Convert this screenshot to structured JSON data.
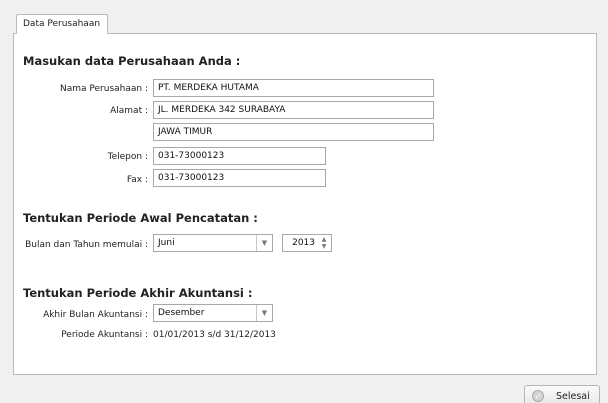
{
  "tab": {
    "label": "Data Perusahaan"
  },
  "company": {
    "heading": "Masukan data Perusahaan Anda :",
    "name_label": "Nama Perusahaan :",
    "name_value": "PT. MERDEKA HUTAMA",
    "address_label": "Alamat :",
    "address_line1": "JL. MERDEKA 342 SURABAYA",
    "address_line2": "JAWA TIMUR",
    "phone_label": "Telepon :",
    "phone_value": "031-73000123",
    "fax_label": "Fax :",
    "fax_value": "031-73000123"
  },
  "start_period": {
    "heading": "Tentukan Periode Awal Pencatatan :",
    "label": "Bulan dan Tahun memulai :",
    "month_value": "Juni",
    "year_value": "2013"
  },
  "end_period": {
    "heading": "Tentukan Periode Akhir Akuntansi :",
    "month_label": "Akhir Bulan Akuntansi :",
    "month_value": "Desember",
    "period_label": "Periode Akuntansi :",
    "period_value": "01/01/2013 s/d 31/12/2013"
  },
  "footer": {
    "finish_label": "Selesai"
  },
  "icons": {
    "dropdown": "chevron-down-icon",
    "spinner": "spinner-arrows-icon",
    "finish": "check-circle-icon"
  }
}
